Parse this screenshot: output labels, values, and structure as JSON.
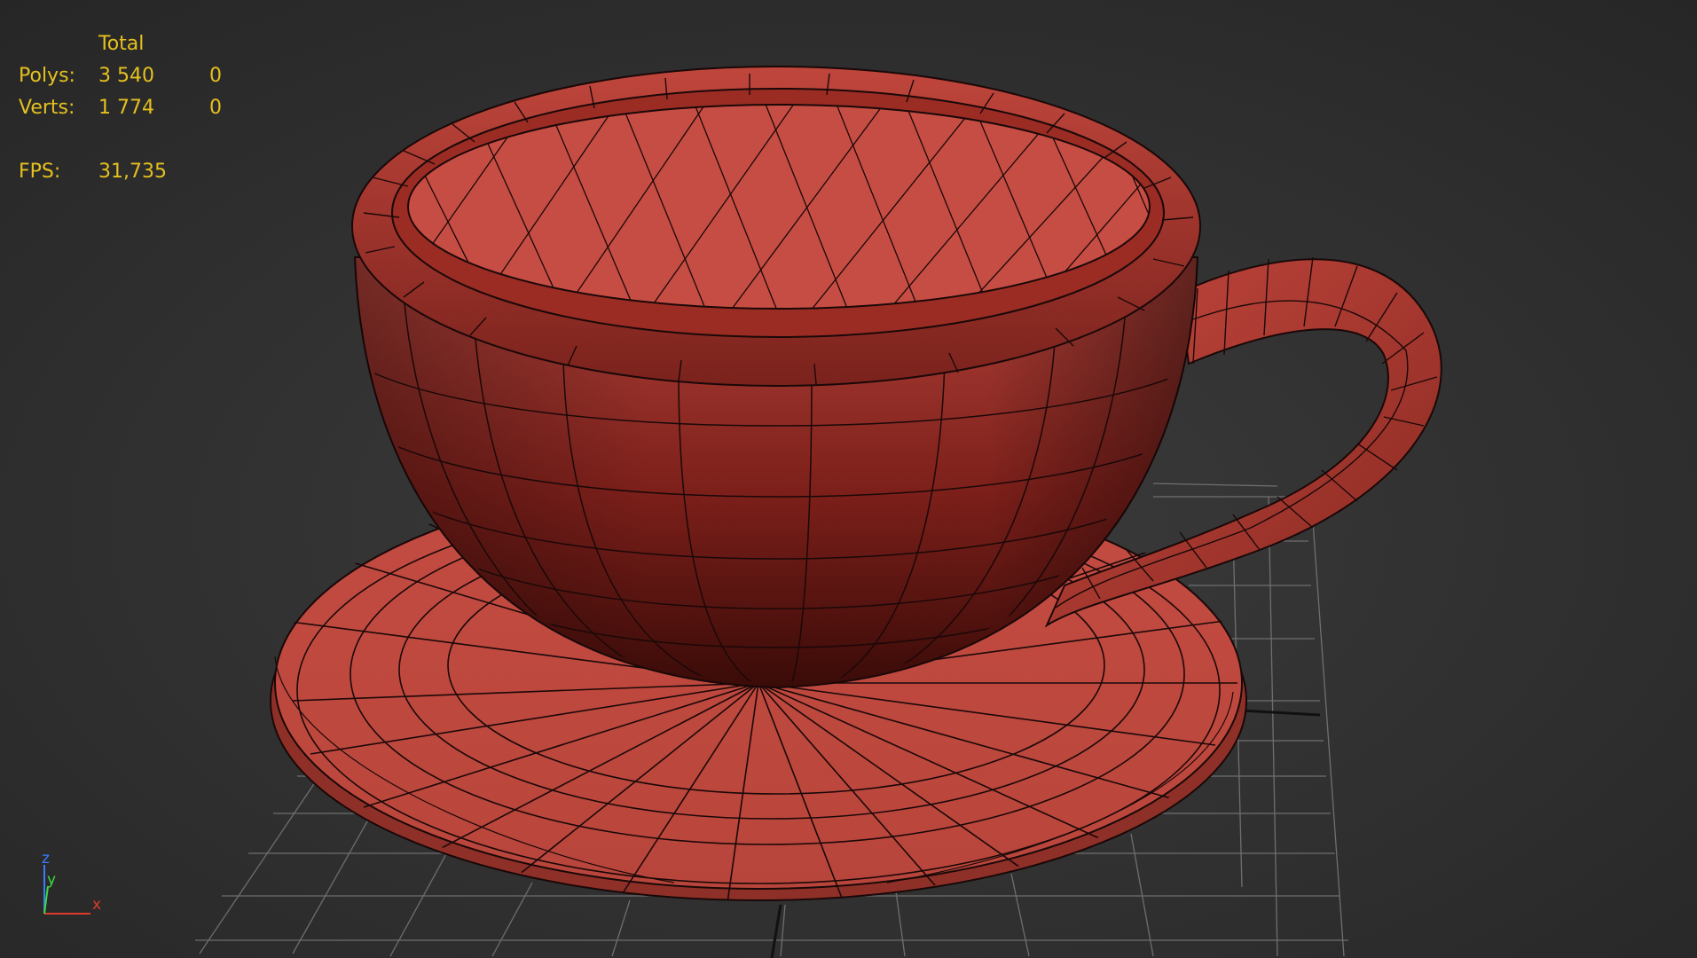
{
  "stats": {
    "total_label": "Total",
    "polys_label": "Polys:",
    "polys_total": "3 540",
    "polys_selected": "0",
    "verts_label": "Verts:",
    "verts_total": "1 774",
    "verts_selected": "0",
    "fps_label": "FPS:",
    "fps_value": "31,735",
    "color": "#e5c020"
  },
  "axis_gizmo": {
    "z_label": "z",
    "y_label": "y",
    "x_label": "x",
    "z_color": "#3a7bff",
    "y_color": "#3adb3a",
    "x_color": "#e03a2a"
  },
  "scene": {
    "object": "teacup-with-saucer",
    "material_color": "#c0463c",
    "background_color": "#2b2b2b",
    "grid_color": "#7a7a7a",
    "wireframe_color": "#1a0808"
  }
}
